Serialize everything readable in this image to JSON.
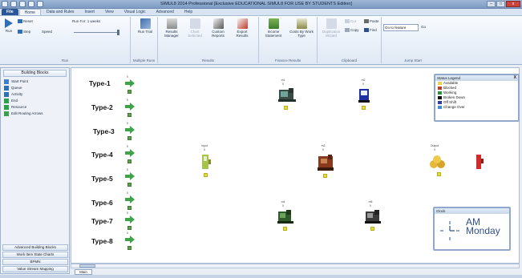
{
  "app": {
    "title": "SIMUL8 2014 Professional [Exclusive EDUCATIONAL SIMUL8 FOR USE BY STUDENTS Edition]"
  },
  "tabs": [
    "File",
    "Home",
    "Data and Rules",
    "Insert",
    "View",
    "Visual Logic",
    "Advanced",
    "Help"
  ],
  "ribbon": {
    "run": {
      "run_label": "Run",
      "reset_label": "Reset",
      "step_label": "Step",
      "speed_label": "Speed",
      "run_for_label": "Run For: 1 weeks",
      "group_label": "Run"
    },
    "trials": {
      "run_trial_label": "Run Trial",
      "group_label": "Multiple Runs"
    },
    "results": {
      "results_manager_label": "Results Manager",
      "chart_selected_label": "Chart Selected",
      "custom_reports_label": "Custom Reports",
      "export_results_label": "Export Results",
      "group_label": "Results"
    },
    "finance": {
      "income_statement_label": "Income Statement",
      "costs_by_work_type_label": "Costs By Work Type",
      "group_label": "Finance Results"
    },
    "clipboard": {
      "duplication_wizard_label": "Duplication Wizard",
      "cut_label": "Cut",
      "copy_label": "Copy",
      "paste_label": "Paste",
      "find_label": "Find",
      "group_label": "Clipboard"
    },
    "jump": {
      "input_value": "Go to feature",
      "go_label": "Go",
      "group_label": "Jump Start"
    }
  },
  "sidebar": {
    "title": "Building Blocks",
    "items": [
      {
        "label": "Start Point",
        "icon": "start-point-icon",
        "color": "#3f7fd0"
      },
      {
        "label": "Queue",
        "icon": "queue-icon",
        "color": "#2f6fb8"
      },
      {
        "label": "Activity",
        "icon": "activity-icon",
        "color": "#2f6fb8"
      },
      {
        "label": "End",
        "icon": "end-icon",
        "color": "#2aa14a"
      },
      {
        "label": "Resource",
        "icon": "resource-icon",
        "color": "#2aa14a"
      },
      {
        "label": "Edit Routing Arrows",
        "icon": "routing-arrows-icon",
        "color": "#3aa04a"
      }
    ],
    "footer": [
      "Advanced Building Blocks",
      "Work Item State Charts",
      "BPMN",
      "Value Stream Mapping"
    ]
  },
  "canvas": {
    "rows": [
      "Type-1",
      "Type-2",
      "Type-3",
      "Type-4",
      "Type-5",
      "Type-6",
      "Type-7",
      "Type-8"
    ],
    "row_counts": [
      "0",
      "0",
      "0",
      "0",
      "0",
      "0",
      "0",
      "0"
    ],
    "machines": [
      {
        "label": "m1",
        "count": "0"
      },
      {
        "label": "m2",
        "count": "0"
      },
      {
        "label": "Input",
        "count": "0"
      },
      {
        "label": "m3",
        "count": "0"
      },
      {
        "label": "Output",
        "count": "0"
      },
      {
        "label": "m4",
        "count": "0"
      },
      {
        "label": "m5",
        "count": "0"
      }
    ]
  },
  "legend": {
    "title": "Status Legend",
    "close": "X",
    "items": [
      {
        "label": "Available",
        "color": "#e8d84a"
      },
      {
        "label": "Blocked",
        "color": "#c0392b"
      },
      {
        "label": "Working",
        "color": "#2f8f3a"
      },
      {
        "label": "Broken Down",
        "color": "#111111"
      },
      {
        "label": "Off Shift",
        "color": "#2c3e9a"
      },
      {
        "label": "Change Over",
        "color": "#3a8fd0"
      }
    ]
  },
  "clock": {
    "title": "Clock",
    "time": "AM",
    "day": "Monday"
  },
  "sheet_tab": "Main"
}
